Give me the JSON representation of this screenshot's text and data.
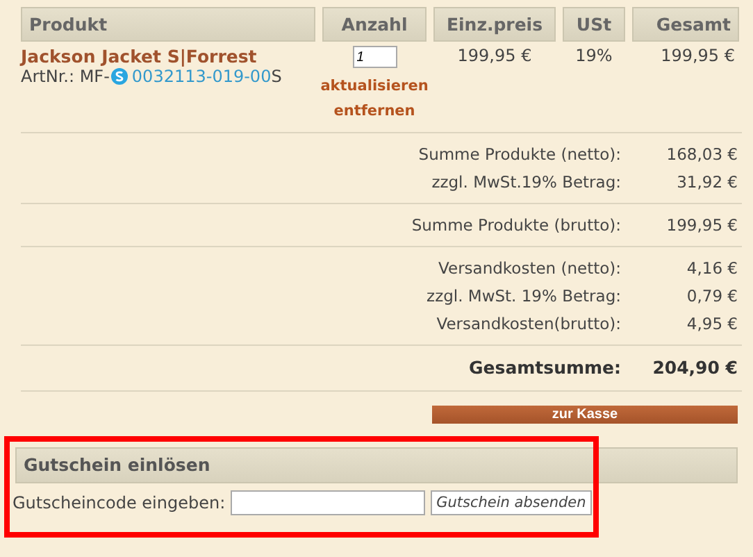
{
  "table": {
    "columns": [
      "Produkt",
      "Anzahl",
      "Einz.preis",
      "USt",
      "Gesamt"
    ],
    "rows": [
      {
        "name": "Jackson Jacket S|Forrest",
        "article_prefix": "ArtNr.: MF-",
        "article_link": "0032113-019-00",
        "article_suffix": "S",
        "quantity": "1",
        "update_link": "aktualisieren",
        "remove_link": "entfernen",
        "unit_price": "199,95  €",
        "tax": "19%",
        "total": "199,95 €"
      }
    ]
  },
  "summary": [
    [
      {
        "label": "Summe Produkte (netto):",
        "value": "168,03 €",
        "bold": false
      },
      {
        "label": "zzgl. MwSt.19% Betrag:",
        "value": "31,92 €",
        "bold": false
      }
    ],
    [
      {
        "label": "Summe Produkte (brutto):",
        "value": "199,95 €",
        "bold": false
      }
    ],
    [
      {
        "label": "Versandkosten (netto):",
        "value": "4,16 €",
        "bold": false
      },
      {
        "label": "zzgl. MwSt. 19% Betrag:",
        "value": "0,79 €",
        "bold": false
      },
      {
        "label": "Versandkosten(brutto):",
        "value": "4,95 €",
        "bold": false
      }
    ],
    [
      {
        "label": "Gesamtsumme:",
        "value": "204,90 €",
        "bold": true
      }
    ]
  ],
  "checkout_button": "zur Kasse",
  "coupon": {
    "title": "Gutschein einlösen",
    "label": "Gutscheincode eingeben:",
    "button": "Gutschein absenden",
    "highlighted": true
  }
}
